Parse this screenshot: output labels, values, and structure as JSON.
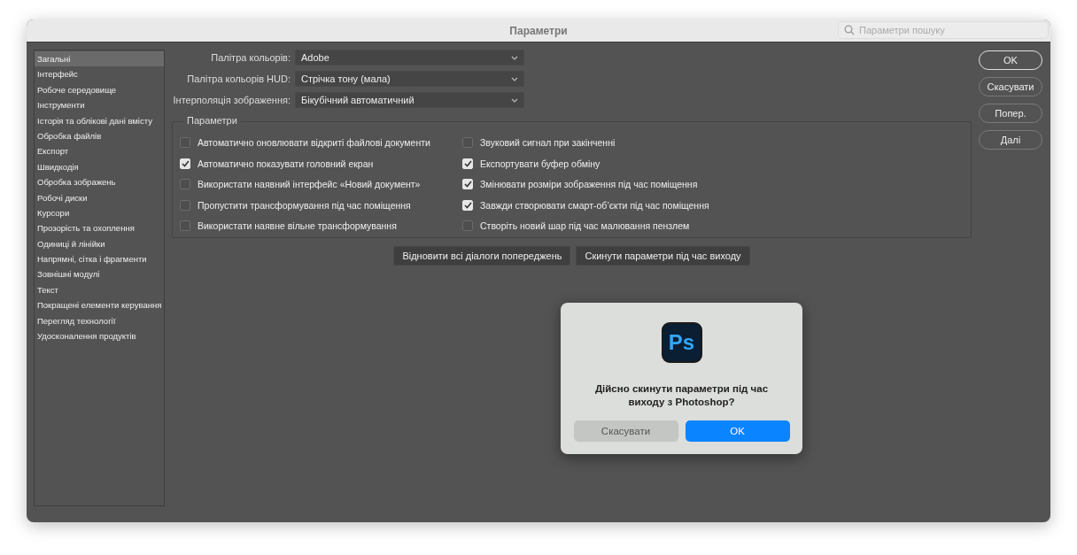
{
  "window": {
    "title": "Параметри"
  },
  "search": {
    "placeholder": "Параметри пошуку"
  },
  "sidebar": {
    "items": [
      {
        "label": "Загальні",
        "selected": true
      },
      {
        "label": "Інтерфейс",
        "selected": false
      },
      {
        "label": "Робоче середовище",
        "selected": false
      },
      {
        "label": "Інструменти",
        "selected": false
      },
      {
        "label": "Історія та облікові дані вмісту",
        "selected": false
      },
      {
        "label": "Обробка файлів",
        "selected": false
      },
      {
        "label": "Експорт",
        "selected": false
      },
      {
        "label": "Швидкодія",
        "selected": false
      },
      {
        "label": "Обробка зображень",
        "selected": false
      },
      {
        "label": "Робочі диски",
        "selected": false
      },
      {
        "label": "Курсори",
        "selected": false
      },
      {
        "label": "Прозорість та охоплення",
        "selected": false
      },
      {
        "label": "Одиниці й лінійки",
        "selected": false
      },
      {
        "label": "Напрямні, сітка і фрагменти",
        "selected": false
      },
      {
        "label": "Зовнішні модулі",
        "selected": false
      },
      {
        "label": "Текст",
        "selected": false
      },
      {
        "label": "Покращені елементи керування",
        "selected": false
      },
      {
        "label": "Перегляд технології",
        "selected": false
      },
      {
        "label": "Удосконалення продуктів",
        "selected": false
      }
    ]
  },
  "dropdowns": [
    {
      "label": "Палітра кольорів:",
      "value": "Adobe"
    },
    {
      "label": "Палітра кольорів HUD:",
      "value": "Стрічка тону (мала)"
    },
    {
      "label": "Інтерполяція зображення:",
      "value": "Бікубічний автоматичний"
    }
  ],
  "options": {
    "title": "Параметри",
    "columns": [
      [
        {
          "label": "Автоматично оновлювати відкриті файлові документи",
          "checked": false
        },
        {
          "label": "Автоматично показувати головний екран",
          "checked": true
        },
        {
          "label": "Використати наявний інтерфейс «Новий документ»",
          "checked": false
        },
        {
          "label": "Пропустити трансформування під час поміщення",
          "checked": false
        },
        {
          "label": "Використати наявне вільне трансформування",
          "checked": false
        }
      ],
      [
        {
          "label": "Звуковий сигнал при закінченні",
          "checked": false
        },
        {
          "label": "Експортувати буфер обміну",
          "checked": true
        },
        {
          "label": "Змінювати розміри зображення під час поміщення",
          "checked": true
        },
        {
          "label": "Завжди створювати смарт-об’єкти під час поміщення",
          "checked": true
        },
        {
          "label": "Створіть новий шар під час малювання пензлем",
          "checked": false
        }
      ]
    ]
  },
  "actions": [
    "Відновити всі діалоги попереджень",
    "Скинути параметри під час виходу"
  ],
  "side_buttons": [
    {
      "label": "OK",
      "default": true
    },
    {
      "label": "Скасувати",
      "default": false
    },
    {
      "label": "Попер.",
      "default": false
    },
    {
      "label": "Далі",
      "default": false
    }
  ],
  "alert": {
    "logo_text": "Ps",
    "message": "Дійсно скинути параметри під час виходу з Photoshop?",
    "buttons": [
      {
        "label": "Скасувати",
        "kind": "secondary"
      },
      {
        "label": "OK",
        "kind": "primary"
      }
    ]
  }
}
